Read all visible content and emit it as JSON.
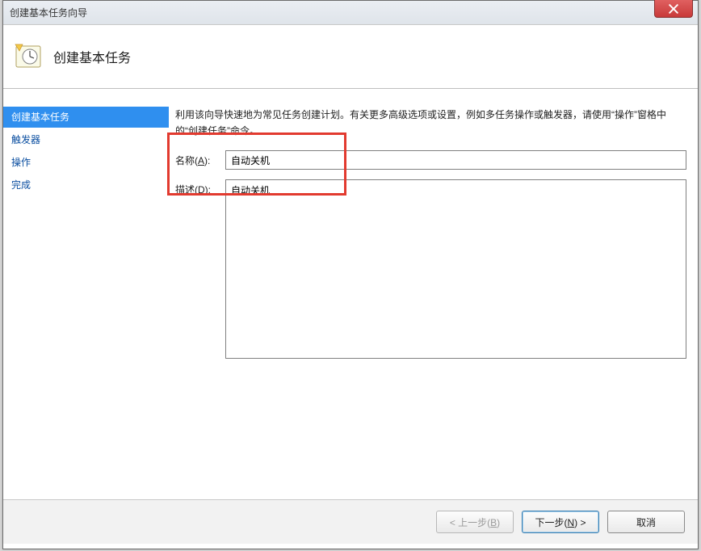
{
  "window": {
    "title": "创建基本任务向导"
  },
  "controls": {
    "close_title": "关闭"
  },
  "header": {
    "title": "创建基本任务"
  },
  "sidebar": {
    "items": [
      {
        "label": "创建基本任务",
        "active": true
      },
      {
        "label": "触发器",
        "active": false
      },
      {
        "label": "操作",
        "active": false
      },
      {
        "label": "完成",
        "active": false
      }
    ]
  },
  "content": {
    "intro": "利用该向导快速地为常见任务创建计划。有关更多高级选项或设置，例如多任务操作或触发器，请使用“操作”窗格中的“创建任务”命令。",
    "name_label": "名称(",
    "name_key": "A",
    "name_label_end": "):",
    "name_value": "自动关机",
    "desc_label": "描述(",
    "desc_key": "D",
    "desc_label_end": "):",
    "desc_value": "自动关机"
  },
  "buttons": {
    "back_pre": "< 上一步(",
    "back_key": "B",
    "back_post": ")",
    "next_pre": "下一步(",
    "next_key": "N",
    "next_post": ") >",
    "cancel": "取消"
  }
}
